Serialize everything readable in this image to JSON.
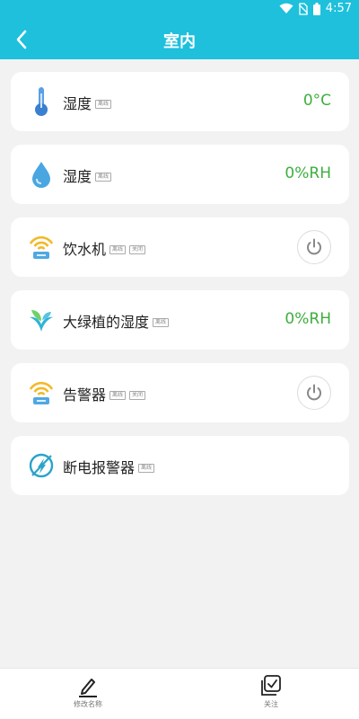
{
  "status_bar": {
    "time": "4:57"
  },
  "header": {
    "title": "室内"
  },
  "devices": [
    {
      "label": "湿度",
      "tags": [
        "离线"
      ],
      "value": "0°C",
      "icon": "thermometer-icon"
    },
    {
      "label": "湿度",
      "tags": [
        "离线"
      ],
      "value": "0%RH",
      "icon": "water-drop-icon"
    },
    {
      "label": "饮水机",
      "tags": [
        "离线",
        "关闭"
      ],
      "icon": "wifi-router-icon",
      "control": "power-icon"
    },
    {
      "label": "大绿植的湿度",
      "tags": [
        "离线"
      ],
      "value": "0%RH",
      "icon": "plant-icon"
    },
    {
      "label": "告警器",
      "tags": [
        "离线",
        "关闭"
      ],
      "icon": "wifi-router-icon",
      "control": "power-icon"
    },
    {
      "label": "断电报警器",
      "tags": [
        "离线"
      ],
      "icon": "power-off-icon"
    }
  ],
  "bottom_bar": {
    "rename_label": "修改名称",
    "follow_label": "关注"
  },
  "colors": {
    "primary": "#1ec0dc",
    "value_green": "#3eae3e",
    "background": "#f2f2f2"
  }
}
